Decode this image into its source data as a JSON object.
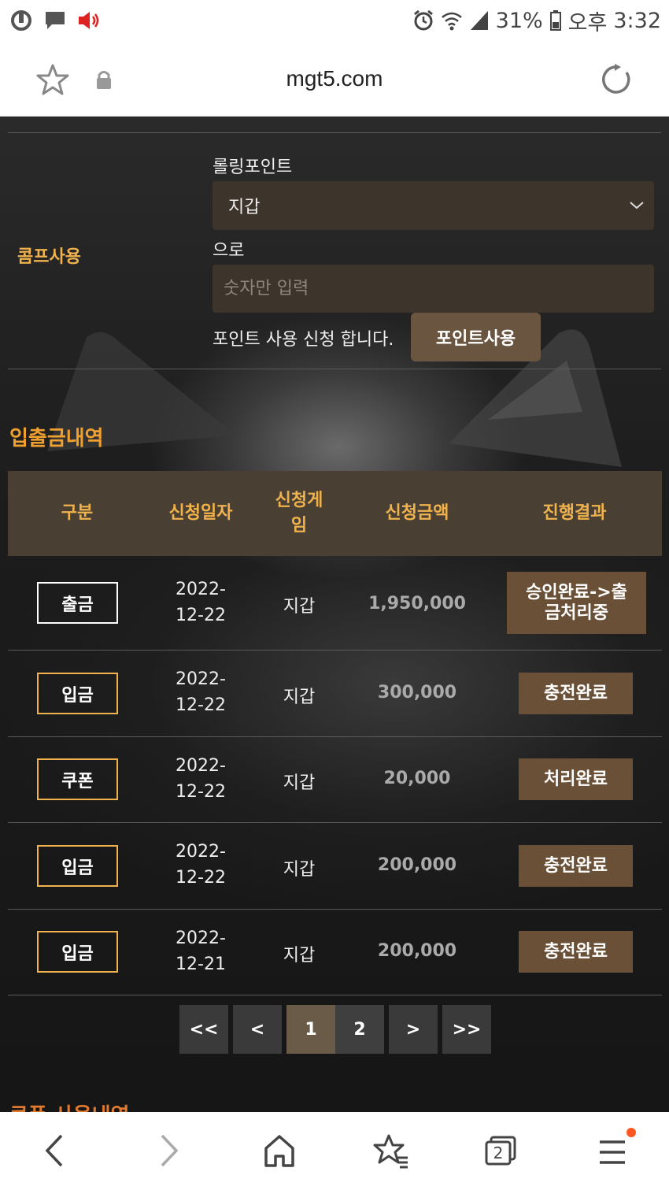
{
  "status_bar": {
    "battery": "31%",
    "ampm": "오후",
    "time": "3:32"
  },
  "address_bar": {
    "url": "mgt5.com"
  },
  "comp": {
    "label": "콤프사용",
    "rolling_label": "롤링포인트",
    "select_value": "지갑",
    "to_label": "으로",
    "input_placeholder": "숫자만 입력",
    "apply_text": "포인트 사용 신청 합니다.",
    "button_label": "포인트사용"
  },
  "history": {
    "title": "입출금내역",
    "headers": [
      "구분",
      "신청일자",
      "신청게\n임",
      "신청금액",
      "진행결과"
    ],
    "rows": [
      {
        "type": "출금",
        "date": "2022-\n12-22",
        "game": "지갑",
        "amount": "1,950,000",
        "result": "승인완료->출\n금처리중"
      },
      {
        "type": "입금",
        "date": "2022-\n12-22",
        "game": "지갑",
        "amount": "300,000",
        "result": "충전완료"
      },
      {
        "type": "쿠폰",
        "date": "2022-\n12-22",
        "game": "지갑",
        "amount": "20,000",
        "result": "처리완료"
      },
      {
        "type": "입금",
        "date": "2022-\n12-22",
        "game": "지갑",
        "amount": "200,000",
        "result": "충전완료"
      },
      {
        "type": "입금",
        "date": "2022-\n12-21",
        "game": "지갑",
        "amount": "200,000",
        "result": "충전완료"
      }
    ]
  },
  "pagination": {
    "first": "<<",
    "prev": "<",
    "page1": "1",
    "page2": "2",
    "next": ">",
    "last": ">>"
  },
  "next_section": {
    "title": "쿠폰 사용내역"
  },
  "bottom_nav": {
    "tab_count": "2"
  },
  "colors": {
    "accent_orange": "#f0b24c",
    "brown": "#6a5036"
  }
}
